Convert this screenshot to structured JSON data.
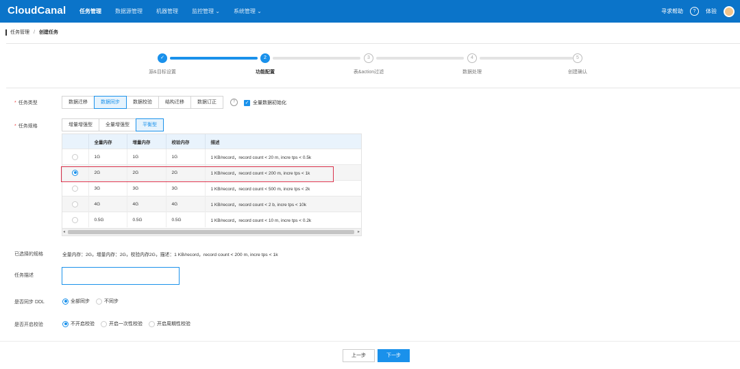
{
  "app": {
    "logo": "CloudCanal"
  },
  "nav": [
    {
      "label": "任务管理",
      "active": true
    },
    {
      "label": "数据源管理",
      "active": false
    },
    {
      "label": "机器管理",
      "active": false
    },
    {
      "label": "监控管理 ⌄",
      "active": false
    },
    {
      "label": "系统管理 ⌄",
      "active": false
    }
  ],
  "topRight": {
    "help": "寻求帮助",
    "help_icon": "?",
    "user": "体验"
  },
  "breadcrumb": {
    "root": "任务管理",
    "sep": "/",
    "current": "创建任务"
  },
  "steps": [
    {
      "num": "✓",
      "label": "源&目标设置",
      "state": "done"
    },
    {
      "num": "2",
      "label": "功能配置",
      "state": "cur"
    },
    {
      "num": "3",
      "label": "表&action过滤",
      "state": "todo"
    },
    {
      "num": "4",
      "label": "数据处理",
      "state": "todo"
    },
    {
      "num": "5",
      "label": "创建确认",
      "state": "todo"
    }
  ],
  "taskType": {
    "label": "任务类型",
    "required": "*",
    "options": [
      "数据迁移",
      "数据同步",
      "数据校验",
      "结构迁移",
      "数据订正"
    ],
    "activeIndex": 1,
    "help_icon": "?",
    "fullInit": {
      "check": "✓",
      "label": "全量数据初始化",
      "checked": true
    }
  },
  "taskSpec": {
    "label": "任务规格",
    "required": "*",
    "options": [
      "增量增强型",
      "全量增强型",
      "平衡型"
    ],
    "activeIndex": 2
  },
  "specTable": {
    "headers": [
      "",
      "全量内存",
      "增量内存",
      "校验内存",
      "描述"
    ],
    "rows": [
      {
        "full": "1G",
        "incr": "1G",
        "check": "1G",
        "desc": "1 KB/record，record count < 20 m, incre tps < 0.5k",
        "selected": false
      },
      {
        "full": "2G",
        "incr": "2G",
        "check": "2G",
        "desc": "1 KB/record，record count < 200 m, incre tps < 1k",
        "selected": true
      },
      {
        "full": "3G",
        "incr": "3G",
        "check": "3G",
        "desc": "1 KB/record，record count < 500 m, incre tps < 2k",
        "selected": false
      },
      {
        "full": "4G",
        "incr": "4G",
        "check": "4G",
        "desc": "1 KB/record，record count < 2 b, incre tps < 10k",
        "selected": false
      },
      {
        "full": "0.5G",
        "incr": "0.5G",
        "check": "0.5G",
        "desc": "1 KB/record，record count < 10 m, incre tps < 0.2k",
        "selected": false
      }
    ],
    "scroll_left": "◂",
    "scroll_right": "▸"
  },
  "selectedSpec": {
    "label": "已选择的规格",
    "value": "全量内存：2G，增量内存：2G，校验内存2G，描述：1 KB/record，record count < 200 m, incre tps < 1k"
  },
  "taskDesc": {
    "label": "任务描述",
    "value": ""
  },
  "syncDdl": {
    "label": "是否同步 DDL",
    "options": [
      {
        "label": "全部同步",
        "selected": true
      },
      {
        "label": "不同步",
        "selected": false
      }
    ]
  },
  "verify": {
    "label": "是否开启校验",
    "options": [
      {
        "label": "不开启校验",
        "selected": true
      },
      {
        "label": "开启一次性校验",
        "selected": false
      },
      {
        "label": "开启周期性校验",
        "selected": false
      }
    ]
  },
  "footer": {
    "prev": "上一步",
    "next": "下一步"
  },
  "colors": {
    "primary": "#1a91eb",
    "header": "#0b74c9",
    "highlight": "#d9304a"
  }
}
